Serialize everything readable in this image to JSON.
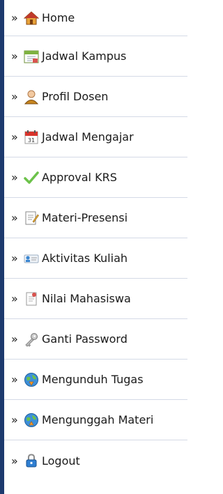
{
  "menu": {
    "bullet": "»",
    "items": [
      {
        "label": "Home",
        "icon": "home-icon"
      },
      {
        "label": "Jadwal Kampus",
        "icon": "calendar-icon"
      },
      {
        "label": "Profil Dosen",
        "icon": "person-icon"
      },
      {
        "label": "Jadwal Mengajar",
        "icon": "date-calendar-icon"
      },
      {
        "label": "Approval KRS",
        "icon": "checkmark-icon"
      },
      {
        "label": "Materi-Presensi",
        "icon": "document-edit-icon"
      },
      {
        "label": "Aktivitas Kuliah",
        "icon": "id-card-icon"
      },
      {
        "label": "Nilai Mahasiswa",
        "icon": "report-icon"
      },
      {
        "label": "Ganti Password",
        "icon": "key-icon"
      },
      {
        "label": "Mengunduh Tugas",
        "icon": "globe-download-icon"
      },
      {
        "label": "Mengunggah Materi",
        "icon": "globe-upload-icon"
      },
      {
        "label": "Logout",
        "icon": "lock-icon"
      }
    ]
  },
  "colors": {
    "rail": "#1d3a6e",
    "divider": "#d4dae6",
    "text": "#1a1a1a"
  }
}
